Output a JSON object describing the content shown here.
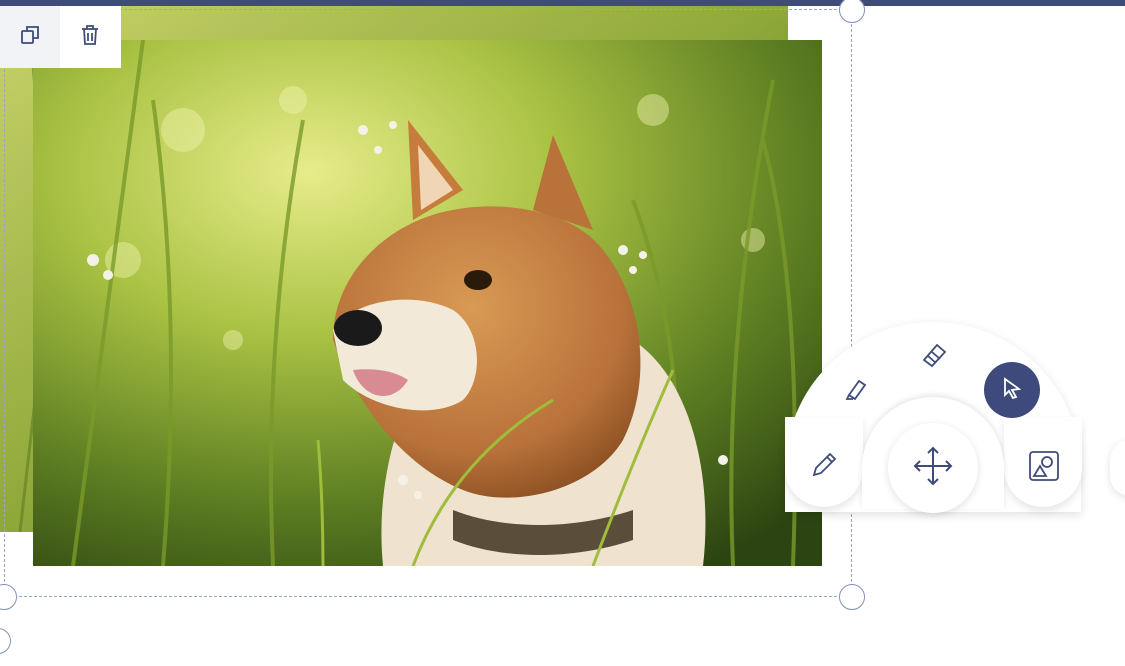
{
  "canvas": {
    "accent_color": "#3f4c7a",
    "image_subject": "shiba-inu-in-grass"
  },
  "mini_toolbar": {
    "items": [
      {
        "icon": "duplicate-icon"
      },
      {
        "icon": "trash-icon"
      }
    ]
  },
  "tool_menu": {
    "tools": [
      {
        "icon": "highlighter-icon"
      },
      {
        "icon": "eraser-icon"
      },
      {
        "icon": "cursor-icon",
        "active": true
      },
      {
        "icon": "pencil-icon"
      },
      {
        "icon": "move-icon"
      },
      {
        "icon": "shapes-icon"
      }
    ],
    "active_color": "#3e4a7c"
  }
}
